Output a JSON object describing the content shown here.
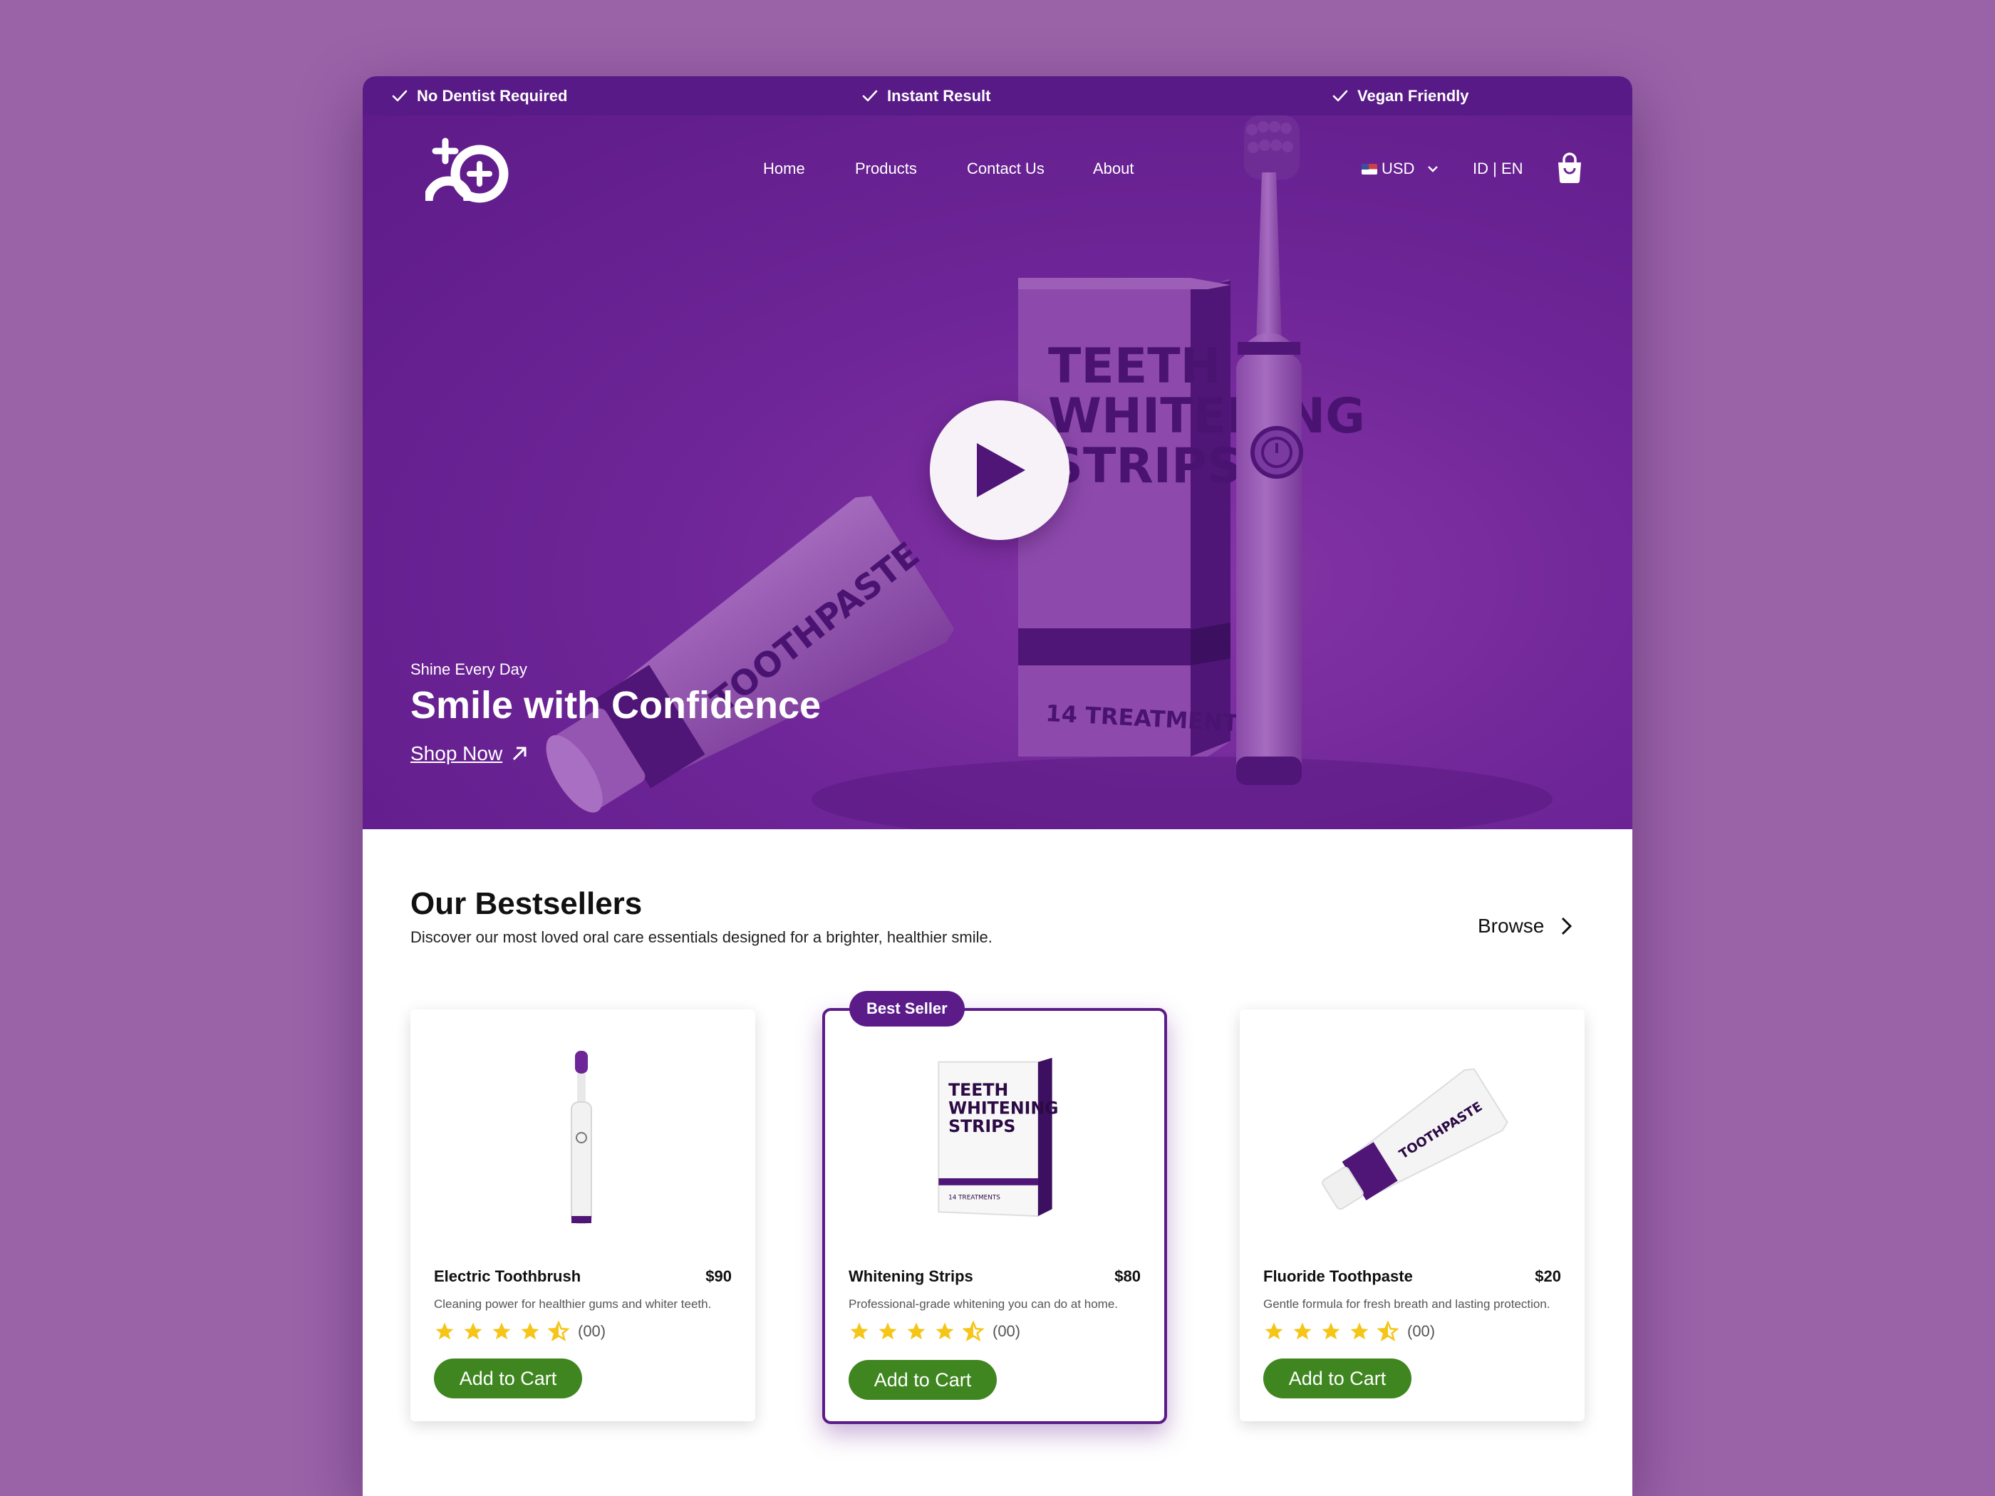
{
  "topbar": {
    "features": [
      "No Dentist Required",
      "Instant Result",
      "Vegan Friendly"
    ]
  },
  "nav": {
    "links": [
      "Home",
      "Products",
      "Contact Us",
      "About"
    ],
    "currency": "USD",
    "language": "ID | EN"
  },
  "hero": {
    "kicker": "Shine Every Day",
    "title": "Smile with Confidence",
    "cta": "Shop Now",
    "box_line1": "TEETH",
    "box_line2": "WHITENING",
    "box_line3": "STRIPS",
    "box_treatments": "14 TREATMENTS",
    "tube_label": "TOOTHPASTE"
  },
  "bestsellers": {
    "title": "Our Bestsellers",
    "subtitle": "Discover our most loved oral care essentials designed for a brighter, healthier smile.",
    "browse_label": "Browse",
    "badge": "Best Seller",
    "add_to_cart": "Add to Cart",
    "products": [
      {
        "name": "Electric Toothbrush",
        "price": "$90",
        "description": "Cleaning power for healthier gums and whiter teeth.",
        "rating": 4.5,
        "reviews": "(00)"
      },
      {
        "name": "Whitening Strips",
        "price": "$80",
        "description": "Professional-grade whitening you can do at home.",
        "rating": 4.5,
        "reviews": "(00)"
      },
      {
        "name": "Fluoride Toothpaste",
        "price": "$20",
        "description": "Gentle formula for fresh breath and lasting protection.",
        "rating": 4.5,
        "reviews": "(00)"
      }
    ],
    "product_box_lines": [
      "TEETH",
      "WHITENING",
      "STRIPS"
    ],
    "product_box_small": "14 TREATMENTS",
    "product_tube_label": "TOOTHPASTE"
  },
  "colors": {
    "brand_purple": "#571a86",
    "hero_purple": "#6e2597",
    "button_green": "#3f8620",
    "star_yellow": "#f5c518",
    "background": "#9a63a8"
  },
  "icons": [
    "check-icon",
    "logo-icon",
    "flag-us-icon",
    "chevron-down-icon",
    "shopping-bag-icon",
    "play-icon",
    "arrow-up-right-icon",
    "chevron-right-icon",
    "star-icon",
    "half-star-icon"
  ]
}
